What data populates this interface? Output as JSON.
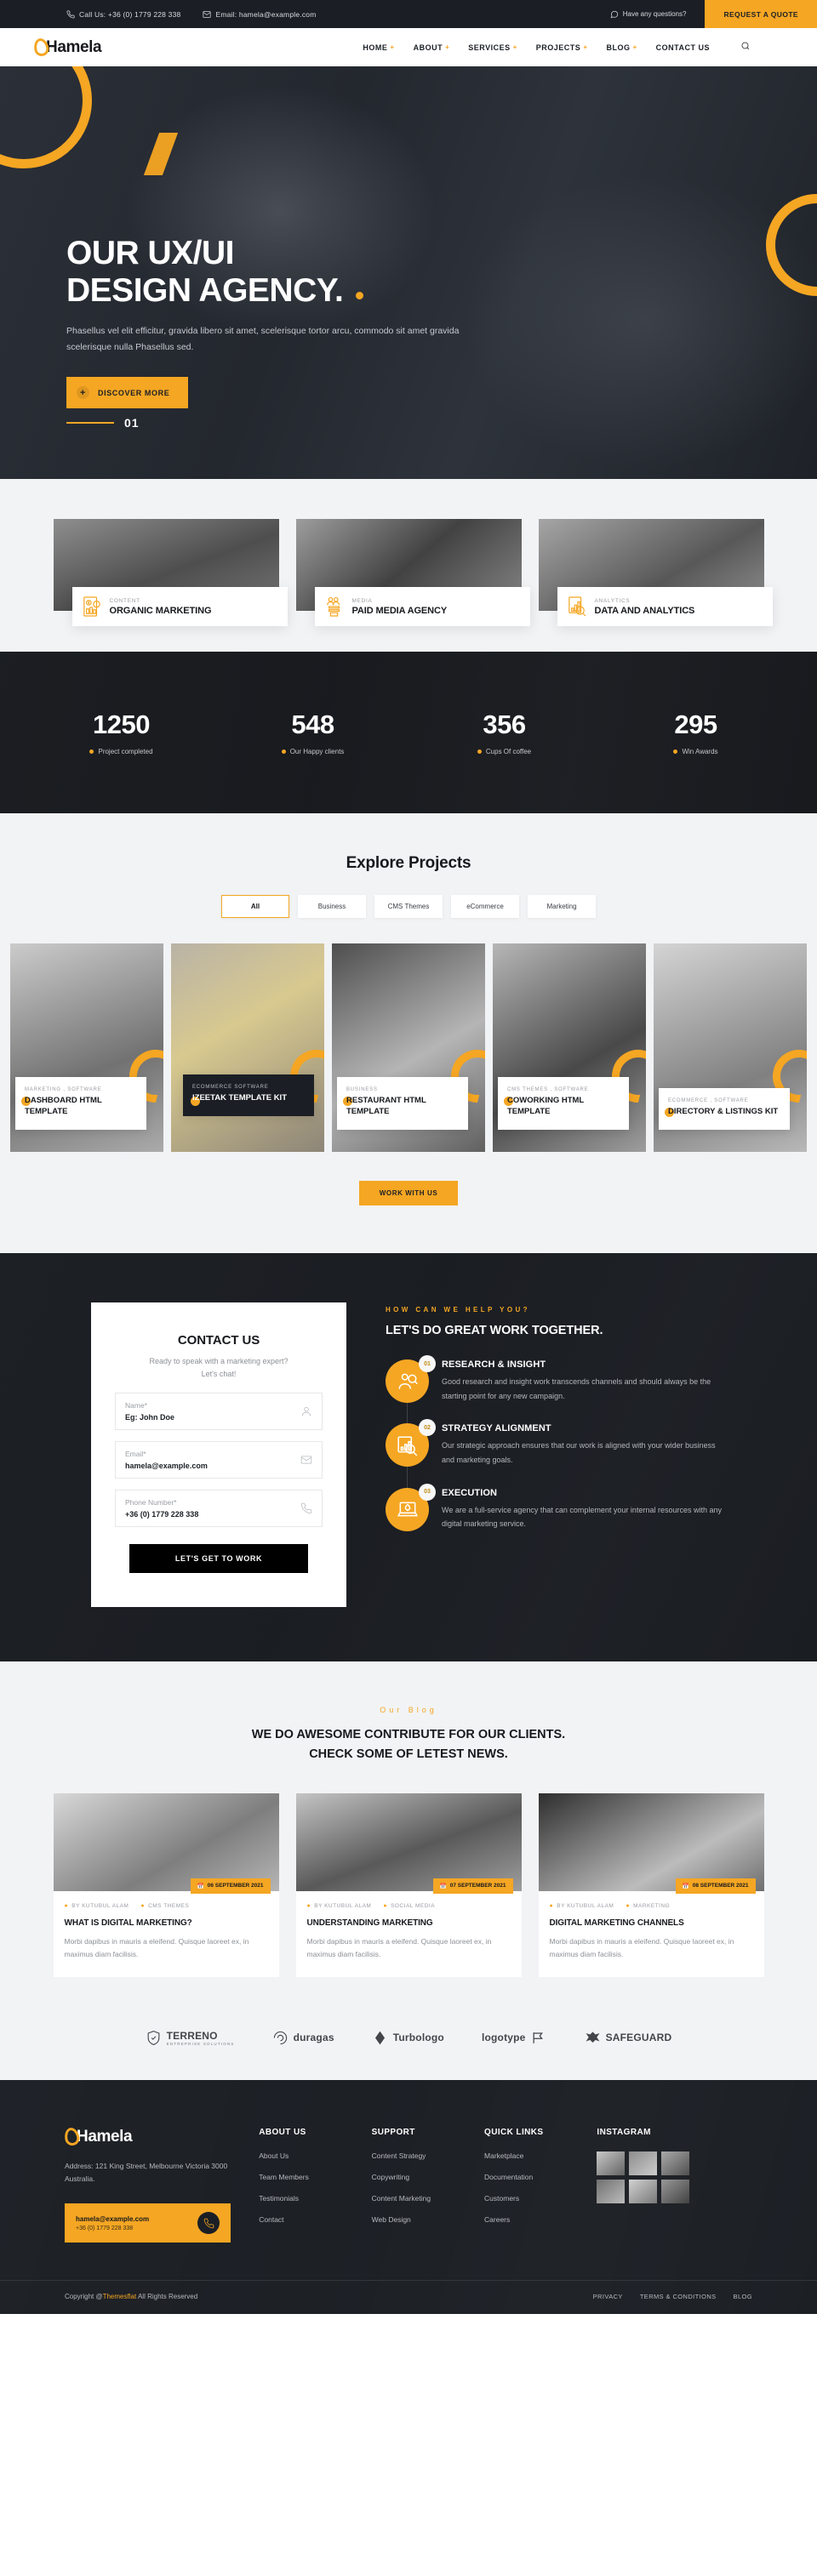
{
  "topbar": {
    "phone": "Call Us: +36 (0) 1779 228 338",
    "email": "Email: hamela@example.com",
    "question": "Have any questions?",
    "quote_button": "REQUEST A QUOTE"
  },
  "header": {
    "logo": "Hamela",
    "nav": [
      {
        "label": "HOME",
        "caret": "+"
      },
      {
        "label": "ABOUT",
        "caret": "+"
      },
      {
        "label": "SERVICES",
        "caret": "+"
      },
      {
        "label": "PROJECTS",
        "caret": "+"
      },
      {
        "label": "BLOG",
        "caret": "+"
      },
      {
        "label": "CONTACT US",
        "caret": ""
      }
    ],
    "search_icon": "search-icon"
  },
  "hero": {
    "title_line1": "OUR UX/UI",
    "title_line2": "DESIGN AGENCY.",
    "paragraph": "Phasellus vel elit efficitur, gravida libero sit amet, scelerisque tortor arcu, commodo sit amet gravida scelerisque nulla Phasellus sed.",
    "button": "DISCOVER MORE",
    "slide_number": "01"
  },
  "services": [
    {
      "category": "CONTENT",
      "title": "ORGANIC MARKETING",
      "icon": "document-dollar-icon"
    },
    {
      "category": "MEDIA",
      "title": "PAID MEDIA AGENCY",
      "icon": "megaphone-group-icon"
    },
    {
      "category": "ANALYTICS",
      "title": "DATA AND ANALYTICS",
      "icon": "chart-search-icon"
    }
  ],
  "counters": [
    {
      "value": "1250",
      "label": "Project completed"
    },
    {
      "value": "548",
      "label": "Our Happy clients"
    },
    {
      "value": "356",
      "label": "Cups Of coffee"
    },
    {
      "value": "295",
      "label": "Win Awards"
    }
  ],
  "projects": {
    "title": "Explore Projects",
    "filters": [
      "All",
      "Business",
      "CMS Themes",
      "eCommerce",
      "Marketing"
    ],
    "active_filter": "All",
    "items": [
      {
        "category": "MARKETING , SOFTWARE",
        "name": "DASHBOARD HTML TEMPLATE",
        "featured": false
      },
      {
        "category": "ECOMMERCE   SOFTWARE",
        "name": "IZEETAK TEMPLATE KIT",
        "featured": true
      },
      {
        "category": "BUSINESS",
        "name": "RESTAURANT HTML TEMPLATE",
        "featured": false
      },
      {
        "category": "CMS THEMES , SOFTWARE",
        "name": "COWORKING HTML TEMPLATE",
        "featured": false
      },
      {
        "category": "ECOMMERCE , SOFTWARE",
        "name": "DIRECTORY & LISTINGS KIT",
        "featured": false
      }
    ],
    "work_button": "WORK WITH US"
  },
  "contact": {
    "title": "CONTACT US",
    "subtitle_line1": "Ready to speak with a marketing expert?",
    "subtitle_line2": "Let's chat!",
    "fields": [
      {
        "label": "Name*",
        "value": "Eg: John Doe",
        "icon": "user-icon"
      },
      {
        "label": "Email*",
        "value": "hamela@example.com",
        "icon": "envelope-icon"
      },
      {
        "label": "Phone Number*",
        "value": "+36 (0) 1779 228 338",
        "icon": "phone-icon"
      }
    ],
    "submit": "LET'S GET TO WORK"
  },
  "help": {
    "eyebrow": "HOW CAN WE HELP YOU?",
    "heading": "LET'S DO GREAT WORK TOGETHER.",
    "steps": [
      {
        "num": "01",
        "title": "RESEARCH & INSIGHT",
        "desc": "Good research and insight work transcends channels and should always be the starting point for any new campaign.",
        "icon": "research-people-icon"
      },
      {
        "num": "02",
        "title": "STRATEGY ALIGNMENT",
        "desc": "Our strategic approach ensures that our work is aligned with your wider business and marketing goals.",
        "icon": "chart-search-icon"
      },
      {
        "num": "03",
        "title": "EXECUTION",
        "desc": "We are a full-service agency that can complement your internal resources with any digital marketing service.",
        "icon": "rocket-laptop-icon"
      }
    ]
  },
  "blog": {
    "eyebrow": "Our Blog",
    "heading_line1": "WE DO AWESOME CONTRIBUTE FOR OUR CLIENTS.",
    "heading_line2": "CHECK SOME OF LETEST NEWS.",
    "posts": [
      {
        "date": "06 SEPTEMBER 2021",
        "author": "BY KUTUBUL ALAM",
        "category": "CMS THEMES",
        "title": "WHAT IS DIGITAL MARKETING?",
        "excerpt": "Morbi dapibus in mauris a eleifend. Quisque laoreet ex, in maximus diam facilisis."
      },
      {
        "date": "07 SEPTEMBER 2021",
        "author": "BY KUTUBUL ALAM",
        "category": "SOCIAL MEDIA",
        "title": "UNDERSTANDING MARKETING",
        "excerpt": "Morbi dapibus in mauris a eleifend. Quisque laoreet ex, in maximus diam facilisis."
      },
      {
        "date": "08 SEPTEMBER 2021",
        "author": "BY KUTUBUL ALAM",
        "category": "MARKETING",
        "title": "DIGITAL MARKETING CHANNELS",
        "excerpt": "Morbi dapibus in mauris a eleifend. Quisque laoreet ex, in maximus diam facilisis."
      }
    ]
  },
  "brands": [
    {
      "name": "TERRENO",
      "sub": "ENTREPRISE SOLUTIONS",
      "icon": "shield-icon"
    },
    {
      "name": "duragas",
      "sub": "",
      "icon": "swirl-icon"
    },
    {
      "name": "Turbologo",
      "sub": "",
      "icon": "diamond-icon"
    },
    {
      "name": "logotype",
      "sub": "",
      "icon": "flag-icon"
    },
    {
      "name": "SAFEGUARD",
      "sub": "",
      "icon": "eagle-icon"
    }
  ],
  "footer": {
    "logo": "Hamela",
    "address": "Address: 121 King Street, Melbourne Victoria 3000 Australia.",
    "contact_email": "hamela@example.com",
    "contact_phone": "+36 (0) 1779 228 338",
    "columns": [
      {
        "heading": "ABOUT US",
        "links": [
          "About Us",
          "Team Members",
          "Testimonials",
          "Contact"
        ]
      },
      {
        "heading": "SUPPORT",
        "links": [
          "Content Strategy",
          "Copywriting",
          "Content Marketing",
          "Web Design"
        ]
      },
      {
        "heading": "QUICK LINKS",
        "links": [
          "Marketplace",
          "Documentation",
          "Customers",
          "Careers"
        ]
      }
    ],
    "instagram_heading": "INSTAGRAM",
    "copyright_pre": "Copyright @",
    "copyright_brand": "Themesflat",
    "copyright_post": " All Rights Reserved",
    "bottom_links": [
      "PRIVACY",
      "TERMS & CONDITIONS",
      "BLOG"
    ]
  },
  "colors": {
    "accent": "#f5a623",
    "dark": "#1b1f25",
    "light_bg": "#f2f3f5"
  }
}
